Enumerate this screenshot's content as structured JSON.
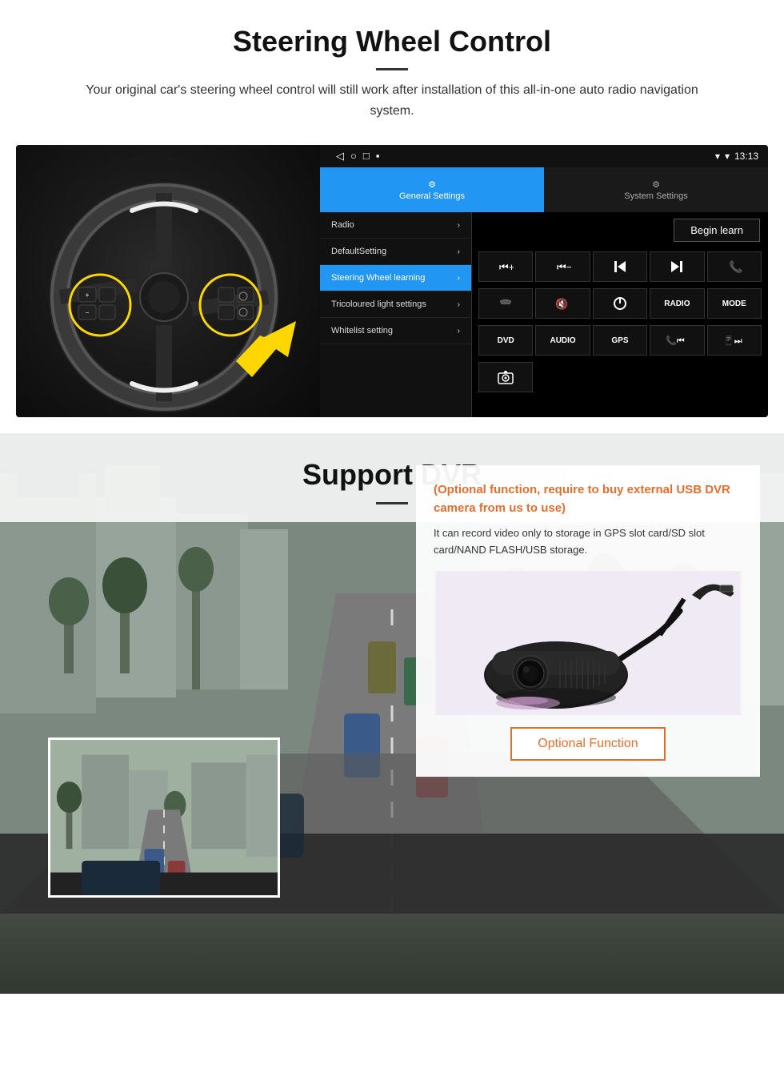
{
  "steering_section": {
    "title": "Steering Wheel Control",
    "subtitle": "Your original car's steering wheel control will still work after installation of this all-in-one auto radio navigation system.",
    "status_bar": {
      "back_icon": "◁",
      "home_icon": "○",
      "recents_icon": "□",
      "menu_icon": "▪",
      "signal_icon": "▾",
      "wifi_icon": "▾",
      "time": "13:13"
    },
    "tabs": [
      {
        "label": "General Settings",
        "icon": "⚙",
        "active": true
      },
      {
        "label": "System Settings",
        "icon": "⚙",
        "active": false
      }
    ],
    "menu_items": [
      {
        "label": "Radio",
        "active": false
      },
      {
        "label": "DefaultSetting",
        "active": false
      },
      {
        "label": "Steering Wheel learning",
        "active": true
      },
      {
        "label": "Tricoloured light settings",
        "active": false
      },
      {
        "label": "Whitelist setting",
        "active": false
      }
    ],
    "begin_learn_btn": "Begin learn",
    "control_buttons_row1": [
      "⏮+",
      "⏮−",
      "⏮",
      "⏭",
      "📞"
    ],
    "control_buttons_row2": [
      "↩",
      "🔇",
      "⏻",
      "RADIO",
      "MODE"
    ],
    "control_buttons_row3": [
      "DVD",
      "AUDIO",
      "GPS",
      "📞⏮",
      "📱⏭"
    ],
    "control_buttons_row4": [
      "📷"
    ]
  },
  "dvr_section": {
    "title": "Support DVR",
    "info_card": {
      "orange_text": "(Optional function, require to buy external USB DVR camera from us to use)",
      "body_text": "It can record video only to storage in GPS slot card/SD slot card/NAND FLASH/USB storage."
    },
    "optional_btn": "Optional Function"
  }
}
